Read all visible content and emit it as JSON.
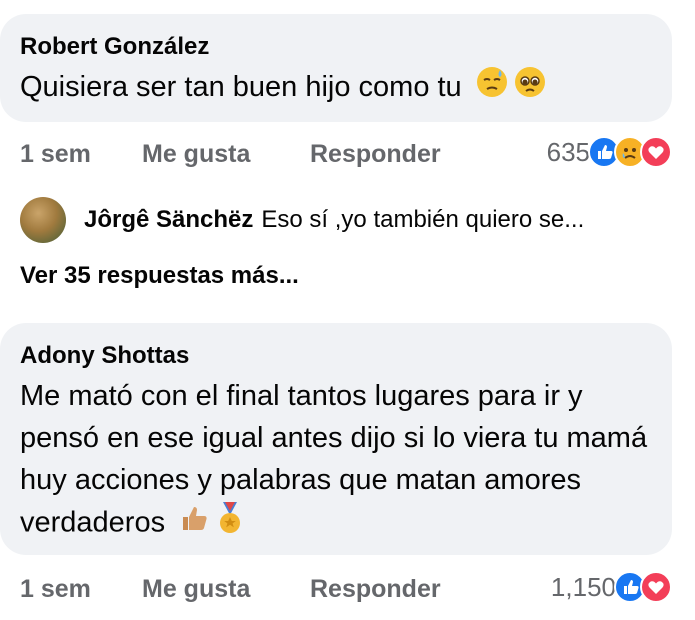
{
  "comments": [
    {
      "author": "Robert González",
      "text": "Quisiera ser tan buen hijo como tu",
      "emojis": [
        "downcast-sweat-face",
        "pleading-face"
      ],
      "time": "1 sem",
      "like_label": "Me gusta",
      "reply_label": "Responder",
      "reaction_count": "635",
      "reactions": [
        "like",
        "sad",
        "love"
      ]
    },
    {
      "author": "Adony Shottas",
      "text": "Me mató con el final tantos lugares para ir y pensó en ese igual antes dijo si lo viera tu mamá huy acciones y palabras que matan amores verdaderos",
      "emojis": [
        "thumbs-up",
        "medal"
      ],
      "time": "1 sem",
      "like_label": "Me gusta",
      "reply_label": "Responder",
      "reaction_count": "1,150",
      "reactions": [
        "like",
        "love"
      ]
    }
  ],
  "reply_preview": {
    "author": "Jôrgê Sänchëz",
    "text": "Eso sí ,yo también quiero se..."
  },
  "more_replies_label": "Ver 35 respuestas más...",
  "colors": {
    "bubble": "#f0f2f5",
    "meta": "#65676b",
    "like": "#1877f2",
    "love": "#f33e58",
    "sad": "#f7b125"
  }
}
